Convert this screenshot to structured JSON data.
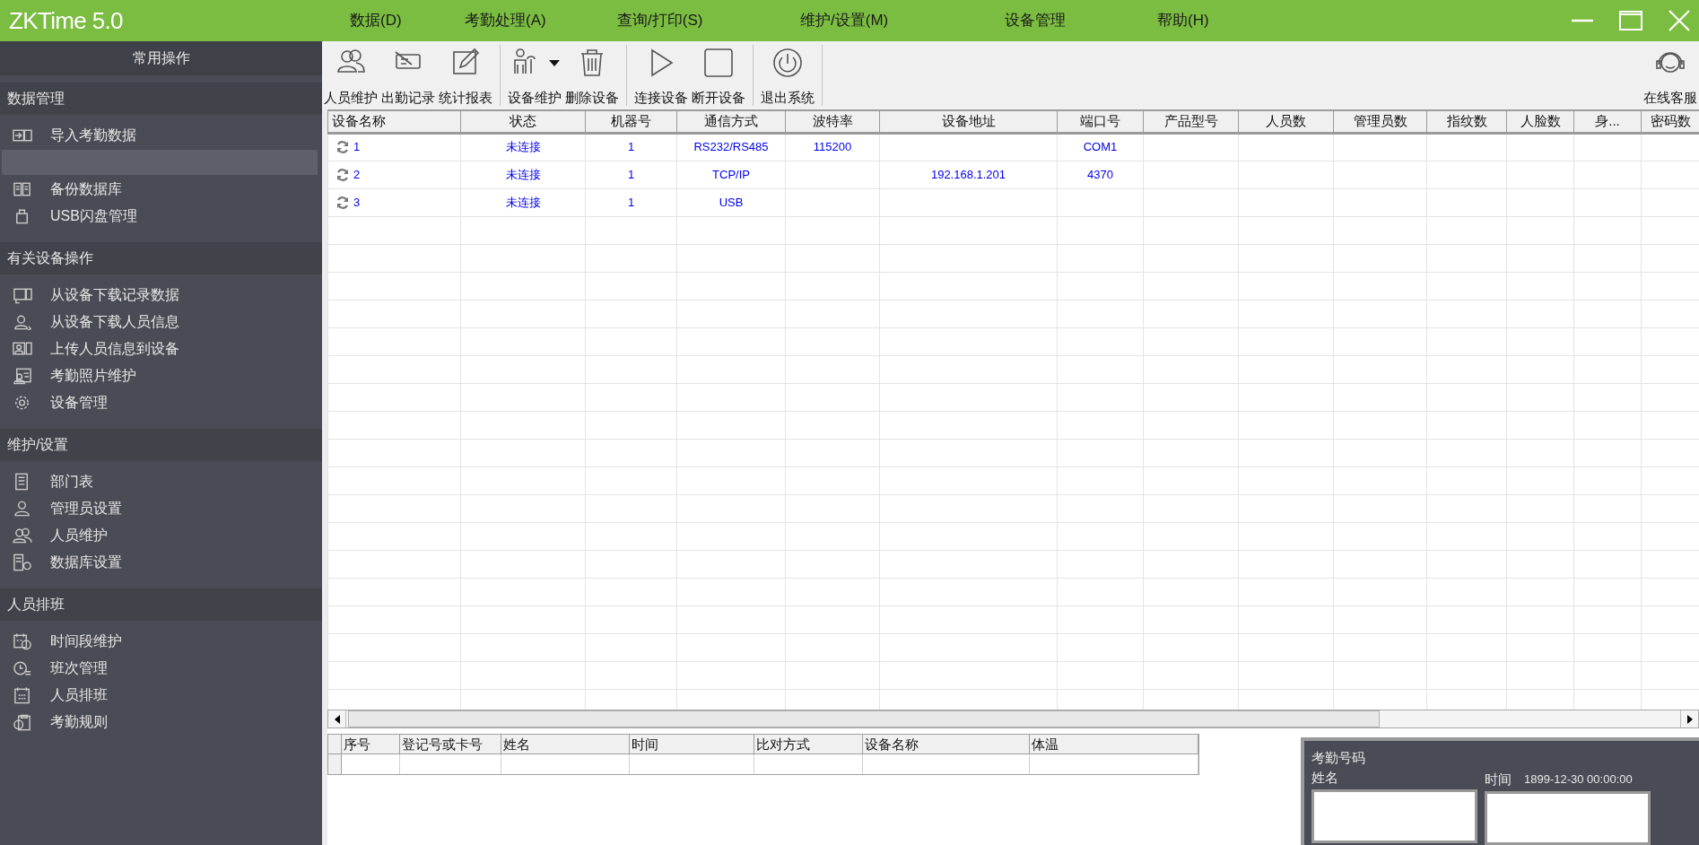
{
  "window": {
    "title": "ZKTime 5.0"
  },
  "menu": [
    "数据(D)",
    "考勤处理(A)",
    "查询/打印(S)",
    "维护/设置(M)",
    "设备管理",
    "帮助(H)"
  ],
  "sidebar": {
    "title": "常用操作",
    "sections": [
      {
        "title": "数据管理",
        "items": [
          {
            "kind": "item",
            "label": "导入考勤数据"
          },
          {
            "kind": "blank"
          },
          {
            "kind": "item",
            "label": "备份数据库"
          },
          {
            "kind": "item",
            "label": "USB闪盘管理"
          }
        ]
      },
      {
        "title": "有关设备操作",
        "items": [
          {
            "kind": "item",
            "label": "从设备下载记录数据"
          },
          {
            "kind": "item",
            "label": "从设备下载人员信息"
          },
          {
            "kind": "item",
            "label": "上传人员信息到设备"
          },
          {
            "kind": "item",
            "label": "考勤照片维护"
          },
          {
            "kind": "item",
            "label": "设备管理"
          }
        ]
      },
      {
        "title": "维护/设置",
        "items": [
          {
            "kind": "item",
            "label": "部门表"
          },
          {
            "kind": "item",
            "label": "管理员设置"
          },
          {
            "kind": "item",
            "label": "人员维护"
          },
          {
            "kind": "item",
            "label": "数据库设置"
          }
        ]
      },
      {
        "title": "人员排班",
        "items": [
          {
            "kind": "item",
            "label": "时间段维护"
          },
          {
            "kind": "item",
            "label": "班次管理"
          },
          {
            "kind": "item",
            "label": "人员排班"
          },
          {
            "kind": "item",
            "label": "考勤规则"
          }
        ]
      }
    ]
  },
  "toolbar": [
    {
      "kind": "button",
      "label": "人员维护"
    },
    {
      "kind": "button",
      "label": "出勤记录"
    },
    {
      "kind": "button",
      "label": "统计报表"
    },
    {
      "kind": "separator"
    },
    {
      "kind": "dropdown",
      "label": "设备维护"
    },
    {
      "kind": "button",
      "label": "删除设备"
    },
    {
      "kind": "separator"
    },
    {
      "kind": "button",
      "label": "连接设备"
    },
    {
      "kind": "button",
      "label": "断开设备"
    },
    {
      "kind": "separator"
    },
    {
      "kind": "button",
      "label": "退出系统"
    },
    {
      "kind": "separator"
    },
    {
      "kind": "right",
      "label": "在线客服"
    }
  ],
  "devices_table": {
    "columns": [
      "设备名称",
      "状态",
      "机器号",
      "通信方式",
      "波特率",
      "设备地址",
      "端口号",
      "产品型号",
      "人员数",
      "管理员数",
      "指纹数",
      "人脸数",
      "身...",
      "密码数"
    ],
    "rows": [
      {
        "cells": [
          "1",
          "未连接",
          "1",
          "RS232/RS485",
          "115200",
          "",
          "COM1"
        ]
      },
      {
        "cells": [
          "2",
          "未连接",
          "1",
          "TCP/IP",
          "",
          "192.168.1.201",
          "4370"
        ]
      },
      {
        "cells": [
          "3",
          "未连接",
          "1",
          "USB"
        ]
      }
    ]
  },
  "records_table": {
    "columns": [
      "序号",
      "登记号或卡号",
      "姓名",
      "时间",
      "比对方式",
      "设备名称",
      "体温"
    ]
  },
  "detail_panel": {
    "id_label": "考勤号码",
    "name_label": "姓名",
    "time_label": "时间",
    "time_value": "1899-12-30 00:00:00"
  }
}
